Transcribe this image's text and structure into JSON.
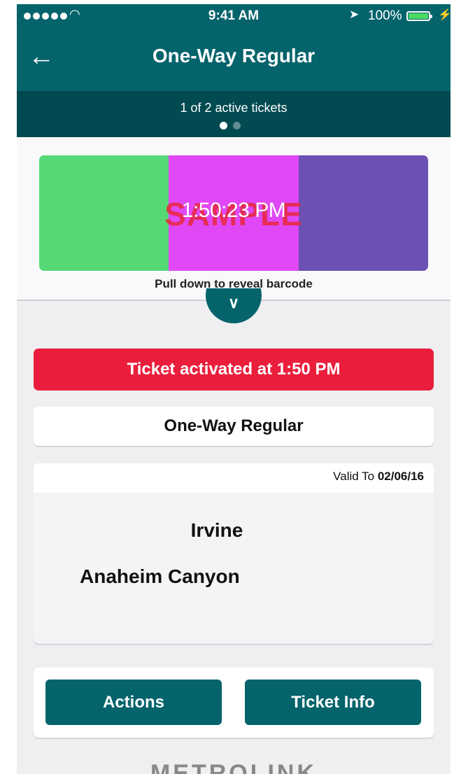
{
  "status_bar": {
    "time": "9:41 AM",
    "battery": "100%",
    "signal_icon": "signal-dots-icon",
    "wifi_icon": "wifi-icon",
    "location_icon": "location-arrow-icon",
    "charging_icon": "bolt-icon"
  },
  "header": {
    "title": "One-Way Regular",
    "back_icon": "arrow-left-icon"
  },
  "ticket_pager": {
    "label": "1 of 2 active tickets",
    "pages": 2,
    "current": 1
  },
  "validation": {
    "colors": [
      "#55d977",
      "#e148f5",
      "#6c50b3"
    ],
    "time": "1:50:23 PM",
    "watermark": "SAMPLE",
    "hint": "Pull down to reveal barcode",
    "pull_icon": "chevron-down-icon"
  },
  "activated_banner": {
    "text": "Ticket activated at 1:50 PM",
    "color": "#ea1e3c"
  },
  "ticket": {
    "type": "One-Way Regular",
    "valid_label": "Valid To",
    "valid_date": "02/06/16",
    "from": "Irvine",
    "to": "Anaheim Canyon"
  },
  "actions": {
    "actions_label": "Actions",
    "info_label": "Ticket Info"
  },
  "brand": "METROLINK",
  "accent": "#04636b"
}
